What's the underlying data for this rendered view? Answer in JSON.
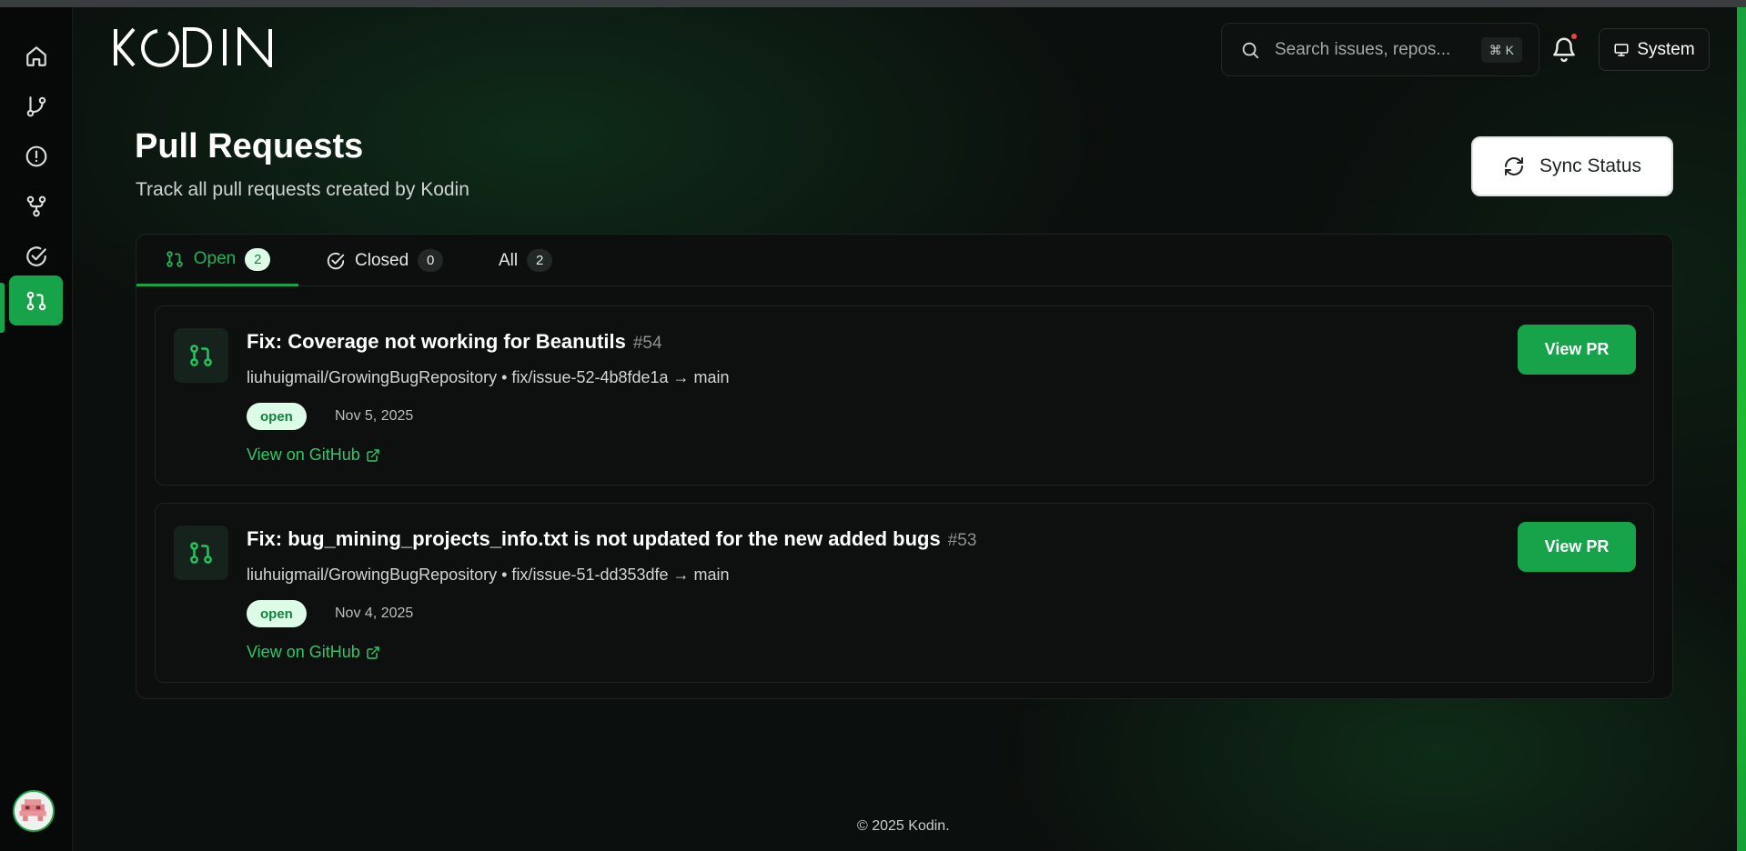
{
  "app": {
    "brand": "KODIN"
  },
  "header": {
    "search_placeholder": "Search issues, repos...",
    "search_shortcut": "⌘ K",
    "theme_label": "System"
  },
  "sidebar": {
    "items": [
      {
        "name": "home",
        "active": false
      },
      {
        "name": "branches",
        "active": false
      },
      {
        "name": "issues",
        "active": false
      },
      {
        "name": "forks",
        "active": false
      },
      {
        "name": "tasks",
        "active": false
      },
      {
        "name": "pull-requests",
        "active": true
      }
    ]
  },
  "page": {
    "title": "Pull Requests",
    "subtitle": "Track all pull requests created by Kodin",
    "sync_button": "Sync Status"
  },
  "tabs": [
    {
      "label": "Open",
      "count": "2",
      "active": true
    },
    {
      "label": "Closed",
      "count": "0",
      "active": false
    },
    {
      "label": "All",
      "count": "2",
      "active": false
    }
  ],
  "pull_requests": [
    {
      "title": "Fix: Coverage not working for Beanutils",
      "number": "#54",
      "branch": "liuhuigmail/GrowingBugRepository • fix/issue-52-4b8fde1a → main",
      "status": "open",
      "date": "Nov 5, 2025",
      "github_link": "View on GitHub",
      "view_button": "View PR"
    },
    {
      "title": "Fix: bug_mining_projects_info.txt is not updated for the new added bugs",
      "number": "#53",
      "branch": "liuhuigmail/GrowingBugRepository • fix/issue-51-dd353dfe → main",
      "status": "open",
      "date": "Nov 4, 2025",
      "github_link": "View on GitHub",
      "view_button": "View PR"
    }
  ],
  "footer": {
    "text": "© 2025 Kodin."
  },
  "colors": {
    "accent": "#16a34a",
    "status_bg": "#dcfce7",
    "status_text": "#15803d",
    "link": "#2ec86a"
  }
}
